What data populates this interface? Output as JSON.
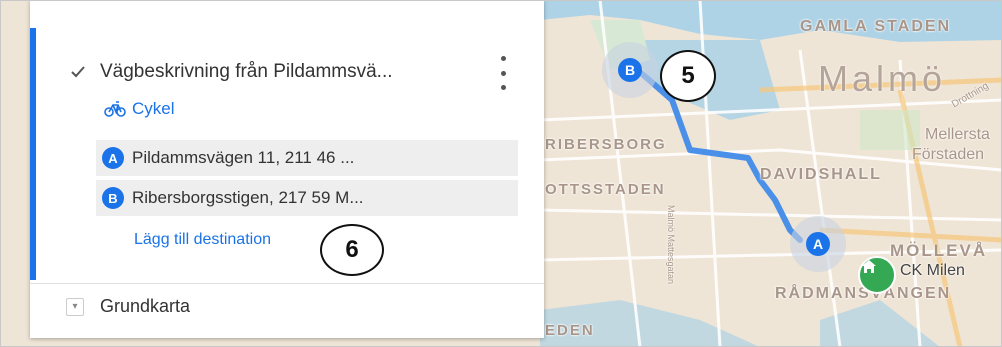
{
  "layer": {
    "title": "Vägbeskrivning från Pildammsvä...",
    "mode_label": "Cykel",
    "stops": [
      {
        "letter": "A",
        "text": "Pildammsvägen 11, 211 46 ..."
      },
      {
        "letter": "B",
        "text": "Ribersborgsstigen, 217 59 M..."
      }
    ],
    "add_destination": "Lägg till destination"
  },
  "base_layer": {
    "title": "Grundkarta"
  },
  "callouts": {
    "five": "5",
    "six": "6"
  },
  "map": {
    "labels": {
      "gamla_staden": "GAMLA STADEN",
      "malmo": "Malmö",
      "ribersborg": "RIBERSBORG",
      "davidshall": "DAVIDSHALL",
      "mellersta": "Mellersta",
      "forstaden": "Förstaden",
      "ottsstaden": "OTTSSTADEN",
      "mollevangen": "MÖLLEVÅ",
      "radmans": "RÅDMANSVÄNGEN",
      "eden": "EDEN",
      "road_small": "Malmö Mattesgatan",
      "road_top": "Drottning"
    },
    "pins": {
      "a": "A",
      "b": "B"
    },
    "home_label": "CK Milen"
  },
  "colors": {
    "accent": "#1a73e8",
    "route": "#4a8fe8",
    "home": "#34a853"
  },
  "icons": [
    "checkbox-checked-icon",
    "more-vert-icon",
    "bicycle-icon",
    "expand-icon",
    "home-icon"
  ]
}
